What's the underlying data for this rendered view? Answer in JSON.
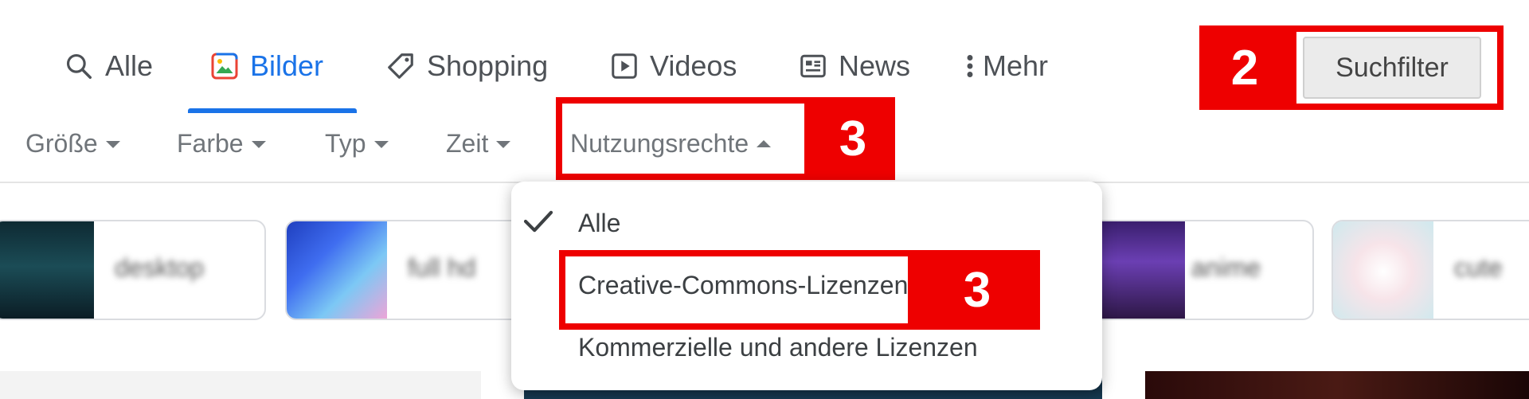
{
  "tabs": [
    {
      "label": "Alle",
      "icon": "search-icon",
      "active": false
    },
    {
      "label": "Bilder",
      "icon": "image-icon",
      "active": true
    },
    {
      "label": "Shopping",
      "icon": "tag-icon",
      "active": false
    },
    {
      "label": "Videos",
      "icon": "play-icon",
      "active": false
    },
    {
      "label": "News",
      "icon": "newspaper-icon",
      "active": false
    },
    {
      "label": "Mehr",
      "icon": "more-vert-icon",
      "active": false
    }
  ],
  "tools_button": {
    "label": "Suchfilter"
  },
  "filters": [
    {
      "label": "Größe",
      "state": "collapsed"
    },
    {
      "label": "Farbe",
      "state": "collapsed"
    },
    {
      "label": "Typ",
      "state": "collapsed"
    },
    {
      "label": "Zeit",
      "state": "collapsed"
    },
    {
      "label": "Nutzungsrechte",
      "state": "expanded"
    }
  ],
  "usage_rights_menu": {
    "options": [
      {
        "label": "Alle",
        "selected": true
      },
      {
        "label": "Creative-Commons-Lizenzen",
        "selected": false
      },
      {
        "label": "Kommerzielle und andere Lizenzen",
        "selected": false
      }
    ]
  },
  "annotations": [
    {
      "label": "2",
      "target": "Suchfilter"
    },
    {
      "label": "3",
      "target": "Nutzungsrechte"
    },
    {
      "label": "3",
      "target": "Creative-Commons-Lizenzen"
    }
  ],
  "suggestion_chips": [
    {
      "label": "desktop",
      "blurred": true
    },
    {
      "label": "full hd",
      "blurred": true
    },
    {
      "label": "anime",
      "blurred": true
    },
    {
      "label": "cute",
      "blurred": true
    }
  ],
  "colors": {
    "accent": "#1a73e8",
    "annotation_red": "#ee0000",
    "tab_text": "#4d5156",
    "filter_text": "#70757a"
  }
}
